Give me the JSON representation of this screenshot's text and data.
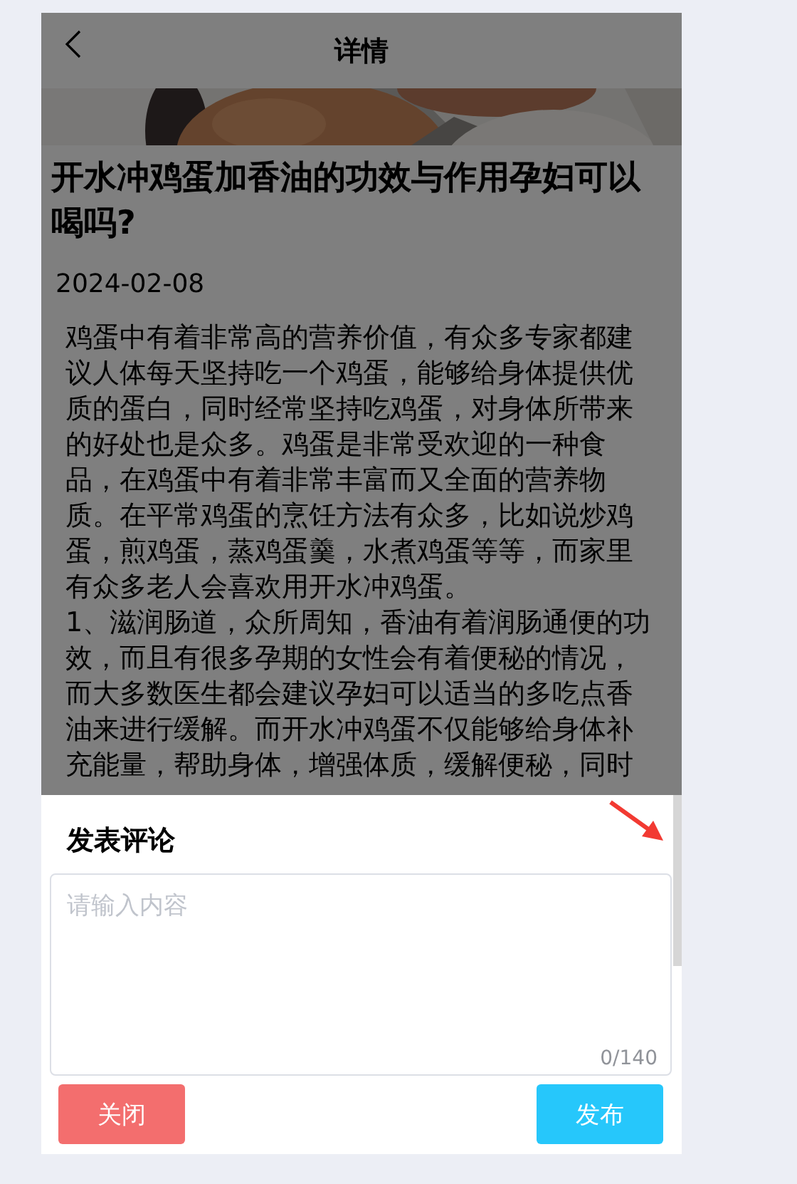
{
  "header": {
    "title": "详情"
  },
  "article": {
    "title": "开水冲鸡蛋加香油的功效与作用孕妇可以喝吗?",
    "date": "2024-02-08",
    "paragraphs": [
      "鸡蛋中有着非常高的营养价值，有众多专家都建议人体每天坚持吃一个鸡蛋，能够给身体提供优质的蛋白，同时经常坚持吃鸡蛋，对身体所带来的好处也是众多。鸡蛋是非常受欢迎的一种食品，在鸡蛋中有着非常丰富而又全面的营养物质。在平常鸡蛋的烹饪方法有众多，比如说炒鸡蛋，煎鸡蛋，蒸鸡蛋羹，水煮鸡蛋等等，而家里有众多老人会喜欢用开水冲鸡蛋。",
      "1、滋润肠道，众所周知，香油有着润肠通便的功效，而且有很多孕期的女性会有着便秘的情况，而大多数医生都会建议孕妇可以适当的多吃点香油来进行缓解。而开水冲鸡蛋不仅能够给身体补充能量，帮助身体，增强体质，缓解便秘，同时"
    ]
  },
  "comment_sheet": {
    "title": "发表评论",
    "placeholder": "请输入内容",
    "counter": "0/140",
    "buttons": [
      {
        "label": "关闭",
        "kind": "close"
      },
      {
        "label": "发布",
        "kind": "submit"
      }
    ]
  }
}
